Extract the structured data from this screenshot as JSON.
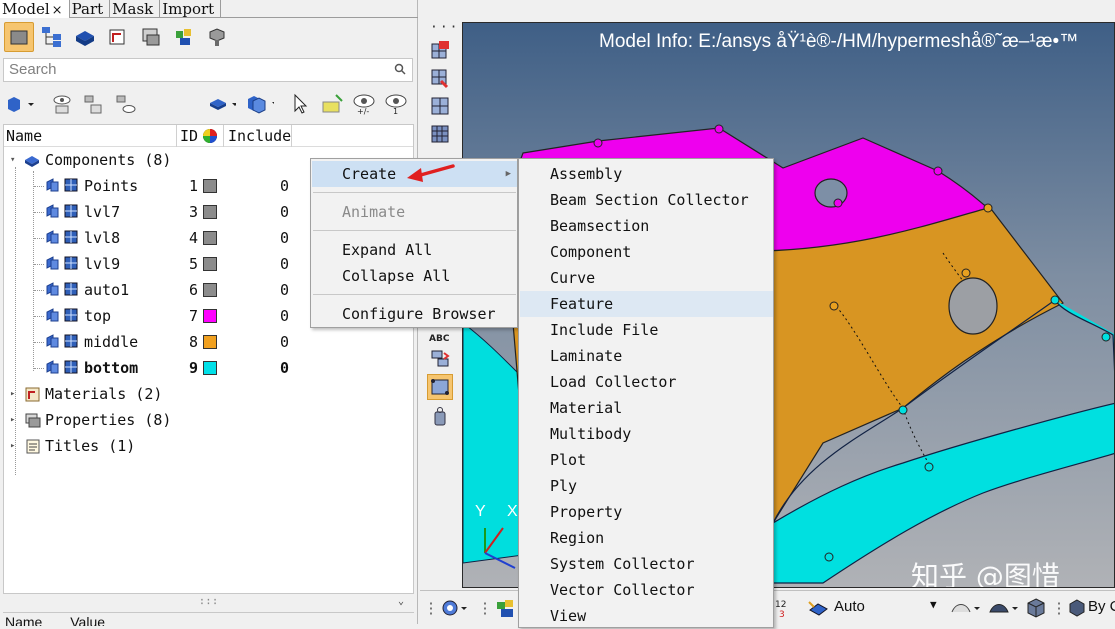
{
  "tabs": [
    {
      "label": "Model",
      "close": "×",
      "active": true
    },
    {
      "label": "Part"
    },
    {
      "label": "Mask"
    },
    {
      "label": "Import"
    }
  ],
  "search": {
    "placeholder": "Search"
  },
  "tree": {
    "columns": {
      "name": "Name",
      "id": "ID",
      "include": "Include"
    },
    "components": {
      "label": "Components",
      "count": "(8)"
    },
    "rows": [
      {
        "name": "Points",
        "id": "1",
        "color": "#8c8c8c",
        "include": "0"
      },
      {
        "name": "lvl7",
        "id": "3",
        "color": "#8c8c8c",
        "include": "0"
      },
      {
        "name": "lvl8",
        "id": "4",
        "color": "#8c8c8c",
        "include": "0"
      },
      {
        "name": "lvl9",
        "id": "5",
        "color": "#8c8c8c",
        "include": "0"
      },
      {
        "name": "auto1",
        "id": "6",
        "color": "#8c8c8c",
        "include": "0"
      },
      {
        "name": "top",
        "id": "7",
        "color": "#ff00ff",
        "include": "0"
      },
      {
        "name": "middle",
        "id": "8",
        "color": "#f0a020",
        "include": "0"
      },
      {
        "name": "bottom",
        "id": "9",
        "color": "#00e0e8",
        "include": "0",
        "bold": true
      }
    ],
    "materials": {
      "label": "Materials",
      "count": "(2)"
    },
    "properties": {
      "label": "Properties",
      "count": "(8)"
    },
    "titles": {
      "label": "Titles",
      "count": "(1)"
    }
  },
  "props_header": {
    "name": "Name",
    "value": "Value"
  },
  "context_menu": {
    "create": "Create",
    "animate": "Animate",
    "expand_all": "Expand All",
    "collapse_all": "Collapse All",
    "configure_browser": "Configure Browser"
  },
  "create_submenu": [
    "Assembly",
    "Beam Section Collector",
    "Beamsection",
    "Component",
    "Curve",
    "Feature",
    "Include File",
    "Laminate",
    "Load Collector",
    "Material",
    "Multibody",
    "Plot",
    "Ply",
    "Property",
    "Region",
    "System Collector",
    "Vector Collector",
    "View"
  ],
  "create_submenu_highlight": "Feature",
  "graphics": {
    "model_info": "Model Info: E:/ansys åŸ¹è®-/HM/hypermeshå®˜æ–¹æ•™",
    "axis_y": "Y",
    "axis_x": "X",
    "watermark": "知乎 @图惜"
  },
  "bottombar": {
    "auto": "Auto",
    "by": "By C"
  },
  "colors": {
    "top": "#ff00ff",
    "middle": "#e8a020",
    "bottom": "#00e0e0",
    "highlight": "#cde0f3",
    "arrow": "#e02020"
  }
}
